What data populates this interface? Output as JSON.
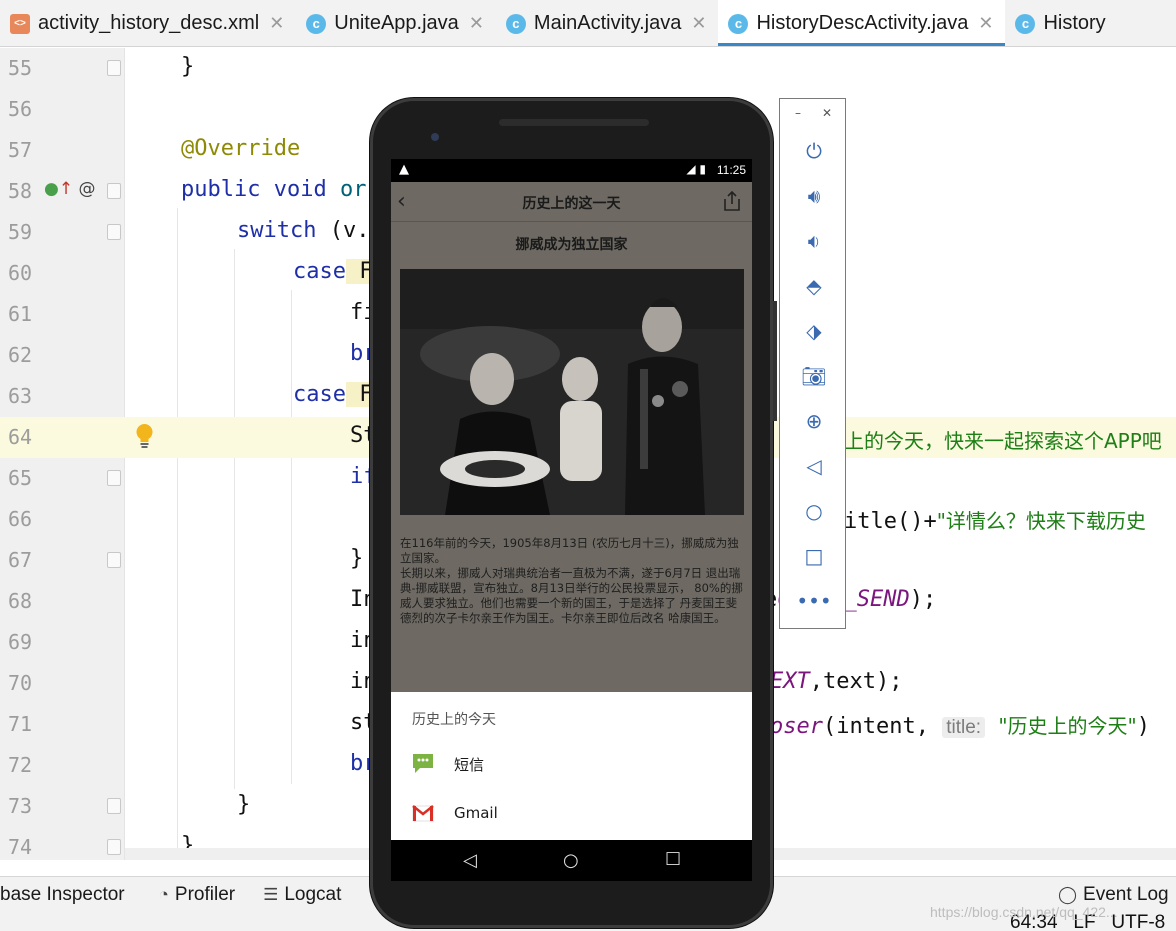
{
  "tabs": [
    {
      "label": "activity_history_desc.xml",
      "icon": "xml-file-icon",
      "active": false
    },
    {
      "label": "UniteApp.java",
      "icon": "class-icon",
      "active": false
    },
    {
      "label": "MainActivity.java",
      "icon": "class-icon",
      "active": false
    },
    {
      "label": "HistoryDescActivity.java",
      "icon": "class-icon",
      "active": true
    },
    {
      "label": "History",
      "icon": "class-icon",
      "active": false
    }
  ],
  "code_lines": [
    {
      "num": "55",
      "text": "}"
    },
    {
      "num": "56",
      "text": ""
    },
    {
      "num": "57",
      "text": "@Override"
    },
    {
      "num": "58",
      "text_kw": "public void",
      "text_rest": " or"
    },
    {
      "num": "59",
      "text_kw": "switch",
      "text_rest": " (v."
    },
    {
      "num": "60",
      "text_kw": "case",
      "text_rest": " F"
    },
    {
      "num": "61",
      "text": "fi"
    },
    {
      "num": "62",
      "text_kw": "br"
    },
    {
      "num": "63",
      "text_kw": "case",
      "text_rest": " F"
    },
    {
      "num": "64",
      "text": "St",
      "right_str": "上的今天，快来一起探索这个APP吧"
    },
    {
      "num": "65",
      "text_kw": "if"
    },
    {
      "num": "66",
      "right_code": "itle()+",
      "right_str": "\"详情么？快来下载历史"
    },
    {
      "num": "67",
      "text": "}"
    },
    {
      "num": "68",
      "text": "In",
      "right_code": "e",
      "right_ital": "CTION_SEND",
      "right_tail": ");"
    },
    {
      "num": "69",
      "text": "in"
    },
    {
      "num": "70",
      "text": "in",
      "right_ital": "EXT",
      "right_code": ",text);"
    },
    {
      "num": "71",
      "text": "st",
      "right_ital": "oser",
      "right_code": "(intent, ",
      "hint": "title:",
      "right_str": "\"历史上的今天\"",
      "right_tail": ")"
    },
    {
      "num": "72",
      "text_kw": "br"
    },
    {
      "num": "73",
      "text": "}"
    },
    {
      "num": "74",
      "text": "}"
    }
  ],
  "toolwindows": [
    {
      "label": "base Inspector",
      "icon": "database-icon"
    },
    {
      "label": "Profiler",
      "icon": "profiler-icon"
    },
    {
      "label": "Logcat",
      "icon": "logcat-icon"
    }
  ],
  "event_log": "Event Log",
  "status": {
    "position": "64:34",
    "line_sep": "LF",
    "encoding": "UTF-8"
  },
  "watermark": "https://blog.csdn.net/qq_422...",
  "phone": {
    "time": "11:25",
    "app_title": "历史上的这一天",
    "article_title": "挪威成为独立国家",
    "article_body": "在116年前的今天，1905年8月13日 (农历七月十三)，挪威成为独立国家。\n长期以来，挪威人对瑞典统治者一直极为不满，遂于6月7日 退出瑞典-挪威联盟，宣布独立。8月13日举行的公民投票显示， 80%的挪威人要求独立。他们也需要一个新的国王，于是选择了 丹麦国王斐德烈的次子卡尔亲王作为国王。卡尔亲王即位后改名 哈康国王。",
    "share_sheet": {
      "title": "历史上的今天",
      "items": [
        {
          "label": "短信",
          "icon": "sms-icon"
        },
        {
          "label": "Gmail",
          "icon": "gmail-icon"
        }
      ]
    }
  },
  "emulator_controls": [
    "power",
    "volume-up",
    "volume-down",
    "rotate-left",
    "rotate-right",
    "screenshot",
    "zoom",
    "back",
    "home",
    "overview",
    "more"
  ]
}
